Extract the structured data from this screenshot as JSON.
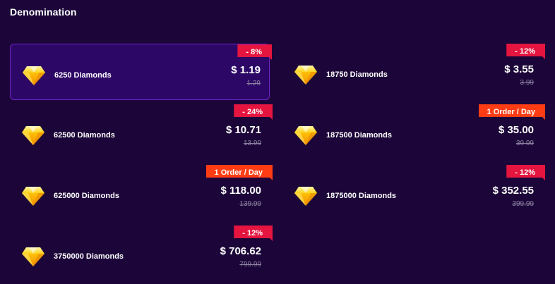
{
  "section": {
    "title": "Denomination"
  },
  "colors": {
    "background": "#1c0639",
    "selected_card": "#2c0766",
    "discount_ribbon": "#e5153f",
    "limit_ribbon": "#ff3c14"
  },
  "items": [
    {
      "name": "6250 Diamonds",
      "price": "$ 1.19",
      "old_price": "1.29",
      "badge": "- 8%",
      "badge_type": "red",
      "selected": true,
      "icon": "diamond-icon"
    },
    {
      "name": "18750 Diamonds",
      "price": "$ 3.55",
      "old_price": "3.99",
      "badge": "- 12%",
      "badge_type": "red",
      "selected": false,
      "icon": "diamond-icon"
    },
    {
      "name": "62500 Diamonds",
      "price": "$ 10.71",
      "old_price": "13.99",
      "badge": "- 24%",
      "badge_type": "red",
      "selected": false,
      "icon": "diamond-icon"
    },
    {
      "name": "187500 Diamonds",
      "price": "$ 35.00",
      "old_price": "39.99",
      "badge": "1 Order / Day",
      "badge_type": "orange",
      "selected": false,
      "icon": "diamond-icon"
    },
    {
      "name": "625000 Diamonds",
      "price": "$ 118.00",
      "old_price": "139.99",
      "badge": "1 Order / Day",
      "badge_type": "orange",
      "selected": false,
      "icon": "diamond-icon"
    },
    {
      "name": "1875000 Diamonds",
      "price": "$ 352.55",
      "old_price": "399.99",
      "badge": "- 12%",
      "badge_type": "red",
      "selected": false,
      "icon": "diamond-icon"
    },
    {
      "name": "3750000 Diamonds",
      "price": "$ 706.62",
      "old_price": "799.99",
      "badge": "- 12%",
      "badge_type": "red",
      "selected": false,
      "icon": "diamond-icon"
    }
  ]
}
